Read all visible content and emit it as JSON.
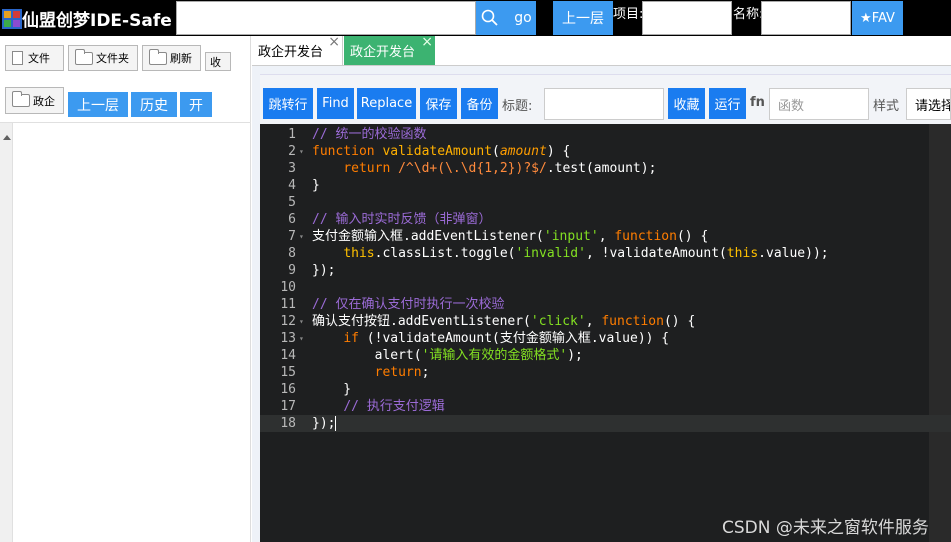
{
  "header": {
    "app_title": "仙盟创梦IDE-Safe",
    "search_value": "",
    "go_label": "go",
    "up_label": "上一层",
    "project_label": "项目:",
    "project_value": "",
    "name_label": "名称:",
    "name_value": "",
    "fav_label": "★FAV"
  },
  "sidebar": {
    "file_label": "文件",
    "folder_label": "文件夹",
    "refresh_label": "刷新",
    "collapse_label": "收",
    "current_folder": "政企",
    "up_label": "上一层",
    "history_label": "历史",
    "open_label": "开"
  },
  "tabs": [
    {
      "label": "政企开发台",
      "close": "×"
    },
    {
      "label": "政企开发台",
      "close": "×"
    }
  ],
  "toolbar": {
    "jump_label": "跳转行",
    "find_label": "Find",
    "replace_label": "Replace",
    "save_label": "保存",
    "backup_label": "备份",
    "title_label": "标题:",
    "title_value": "",
    "fav_label": "收藏",
    "run_label": "运行",
    "fn_label": "fn",
    "function_placeholder": "函数",
    "style_label": "样式",
    "style_select": "请选择"
  },
  "editor": {
    "lines": [
      {
        "n": "1",
        "fold": "",
        "text": "// 统一的校验函数"
      },
      {
        "n": "2",
        "fold": "▾",
        "text": "function validateAmount(amount) {"
      },
      {
        "n": "3",
        "fold": "",
        "text": "    return /^\\d+(\\.\\d{1,2})?$/.test(amount);"
      },
      {
        "n": "4",
        "fold": "",
        "text": "}"
      },
      {
        "n": "5",
        "fold": "",
        "text": ""
      },
      {
        "n": "6",
        "fold": "",
        "text": "// 输入时实时反馈（非弹窗）"
      },
      {
        "n": "7",
        "fold": "▾",
        "text": "支付金额输入框.addEventListener('input', function() {"
      },
      {
        "n": "8",
        "fold": "",
        "text": "    this.classList.toggle('invalid', !validateAmount(this.value));"
      },
      {
        "n": "9",
        "fold": "",
        "text": "});"
      },
      {
        "n": "10",
        "fold": "",
        "text": ""
      },
      {
        "n": "11",
        "fold": "",
        "text": "// 仅在确认支付时执行一次校验"
      },
      {
        "n": "12",
        "fold": "▾",
        "text": "确认支付按钮.addEventListener('click', function() {"
      },
      {
        "n": "13",
        "fold": "▾",
        "text": "    if (!validateAmount(支付金额输入框.value)) {"
      },
      {
        "n": "14",
        "fold": "",
        "text": "        alert('请输入有效的金额格式');"
      },
      {
        "n": "15",
        "fold": "",
        "text": "        return;"
      },
      {
        "n": "16",
        "fold": "",
        "text": "    }"
      },
      {
        "n": "17",
        "fold": "",
        "text": "    // 执行支付逻辑"
      },
      {
        "n": "18",
        "fold": "",
        "text": "});"
      }
    ],
    "active_line": 18
  },
  "watermark": "CSDN @未来之窗软件服务",
  "colors": {
    "accent": "#1a7cf0",
    "editor_bg": "#1e1f20",
    "active_tab": "#3cb371"
  }
}
